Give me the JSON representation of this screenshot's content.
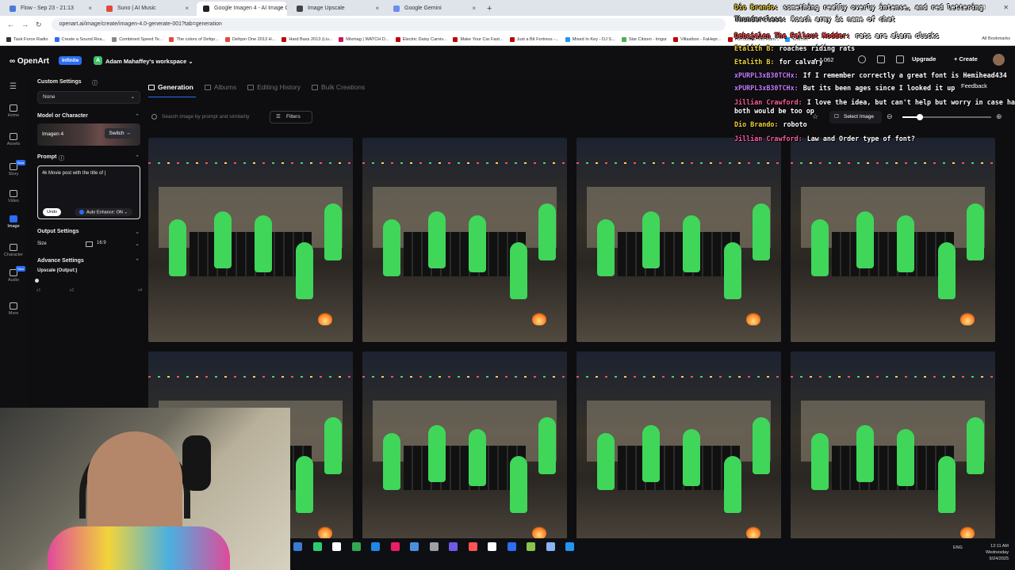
{
  "browser": {
    "tabs": [
      {
        "label": "Flow - Sep 23 - 21:13",
        "color": "#4a7bd8",
        "active": false
      },
      {
        "label": "Suno | AI Music",
        "color": "#e04a3a",
        "active": false
      },
      {
        "label": "Google Imagen 4 - AI Image G...",
        "color": "#222222",
        "active": true
      },
      {
        "label": "Image Upscale",
        "color": "#444444",
        "active": false
      },
      {
        "label": "Google Gemini",
        "color": "#6a8ef0",
        "active": false
      }
    ],
    "url": "openart.ai/image/create/imagen-4.0-generate-001?tab=generation",
    "bookmarks": [
      {
        "label": "Task Force Radio",
        "color": "#333333"
      },
      {
        "label": "Create a Sound Rea...",
        "color": "#2b6df5"
      },
      {
        "label": "Combined Speed Te...",
        "color": "#888888"
      },
      {
        "label": "The colors of Defqo...",
        "color": "#e04a3a"
      },
      {
        "label": "Defqon One 2013 H...",
        "color": "#e04a3a"
      },
      {
        "label": "Hard Bass 2013 (Liv...",
        "color": "#c00000"
      },
      {
        "label": "Mixmag | WATCH D...",
        "color": "#c2185b"
      },
      {
        "label": "Electric Daisy Carniv...",
        "color": "#c00000"
      },
      {
        "label": "Make Your Car Fast...",
        "color": "#c00000"
      },
      {
        "label": "Just a Bit Fortress -...",
        "color": "#c00000"
      },
      {
        "label": "Mixed In Key - DJ S...",
        "color": "#2196f3"
      },
      {
        "label": "Star Citizen - Imgur",
        "color": "#4caf50"
      },
      {
        "label": "Villasibox - FaHepr...",
        "color": "#c00000"
      },
      {
        "label": "Forrobo 30 min Rum...",
        "color": "#c00000"
      },
      {
        "label": "Kritt.net",
        "color": "#2196f3"
      }
    ],
    "all_bookmarks": "All Bookmarks"
  },
  "app": {
    "logo": "OpenArt",
    "plan_badge": "Infinite",
    "workspace_initial": "A",
    "workspace": "Adam Mahaffey's workspace",
    "credits": "4,062",
    "upgrade": "Upgrade",
    "create": "+ Create",
    "feedback": "Feedback"
  },
  "rail": [
    {
      "label": "Home",
      "active": false
    },
    {
      "label": "Assets",
      "active": false
    },
    {
      "label": "Story",
      "active": false,
      "badge": "Beta"
    },
    {
      "label": "Video",
      "active": false
    },
    {
      "label": "Image",
      "active": true
    },
    {
      "label": "Character",
      "active": false
    },
    {
      "label": "Audio",
      "active": false,
      "badge": "New"
    },
    {
      "label": "More",
      "active": false
    }
  ],
  "panel": {
    "custom_settings": "Custom Settings",
    "custom_value": "None",
    "model_heading": "Model or Character",
    "model_name": "Imagen 4",
    "switch": "Switch",
    "prompt_heading": "Prompt",
    "prompt_text": "4k Movie post with the title of |",
    "undo": "Undo",
    "auto_enhance": "Auto Enhance: ON",
    "output_heading": "Output Settings",
    "size_label": "Size",
    "size_value": "16:9",
    "advanced_heading": "Advance Settings",
    "upscale_label": "Upscale (Output:)",
    "upscale_ticks": [
      "x1",
      "x2",
      "x4"
    ]
  },
  "gallery": {
    "tabs": [
      {
        "label": "Generation",
        "active": true
      },
      {
        "label": "Albums",
        "active": false
      },
      {
        "label": "Editing History",
        "active": false
      },
      {
        "label": "Bulk Creations",
        "active": false
      }
    ],
    "search_placeholder": "Search image by prompt and similarity",
    "filters": "Filters",
    "select_image": "Select Image",
    "zoom_level": 0.2
  },
  "chat": [
    {
      "user": "Dio Brando:",
      "color": "#f2d43a",
      "text": "something really overly intense, and red lettering"
    },
    {
      "user": "Thunderclese:",
      "color": "#b0b0b0",
      "text": "Roach army is name of chat"
    },
    {
      "user": "Debajalen The Fallout Modder:",
      "color": "#ff4d4d",
      "text": "rats are alarm clucks"
    },
    {
      "user": "Etalith B:",
      "color": "#f2d43a",
      "text": "roaches riding rats"
    },
    {
      "user": "Etalith B:",
      "color": "#f2d43a",
      "text": "for calvary"
    },
    {
      "user": "xPURPL3xB30TCHx:",
      "color": "#c77dff",
      "text": "If I remember correctly a great font is Hemihead434"
    },
    {
      "user": "xPURPL3xB30TCHx:",
      "color": "#c77dff",
      "text": "But its been ages since I looked it up"
    },
    {
      "user": "Jillian Crawford:",
      "color": "#ff5fa2",
      "text": "I love the idea, but can't help but worry in case having"
    },
    {
      "user": "",
      "color": "#ffffff",
      "text": "both would be too op"
    },
    {
      "user": "Dio Brando:",
      "color": "#f2d43a",
      "text": "roboto"
    },
    {
      "user": "Jillian Crawford:",
      "color": "#ff5fa2",
      "text": "Law and Order type of font?"
    }
  ],
  "taskbar": {
    "lang": "ENG",
    "time": "12:11 AM",
    "day": "Wednesday",
    "date": "9/24/2025"
  }
}
